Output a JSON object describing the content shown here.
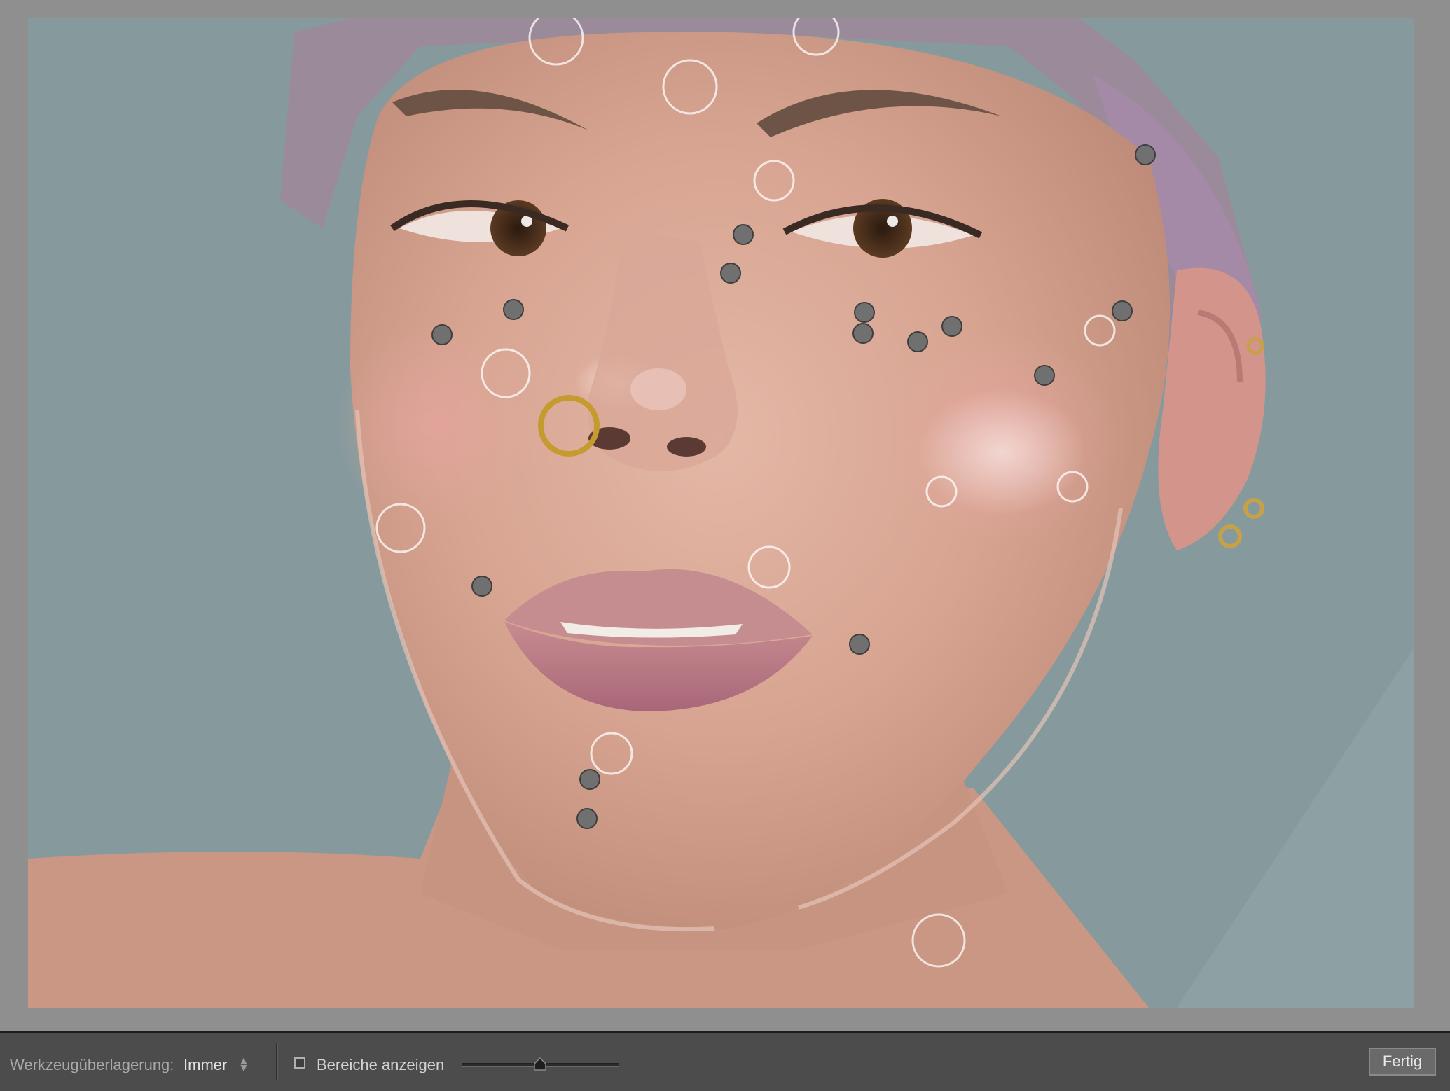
{
  "toolbar": {
    "overlay_label": "Werkzeugüberlagerung:",
    "overlay_value": "Immer",
    "show_areas_label": "Bereiche anzeigen",
    "show_areas_checked": false,
    "brush_size_fraction": 0.5,
    "done_label": "Fertig"
  },
  "canvas": {
    "content": "portrait photo with spot-removal pins"
  },
  "colors": {
    "workspace": "#8f8f8f",
    "toolbar": "#4c4c4c",
    "pin_fill": "#707070",
    "pin_ring": "#ffffff"
  }
}
